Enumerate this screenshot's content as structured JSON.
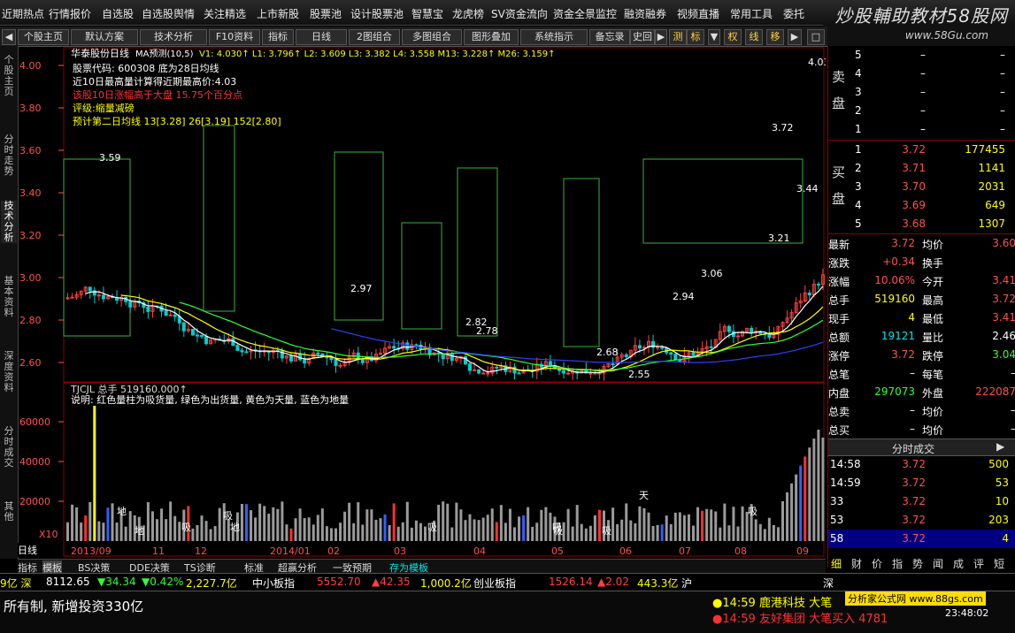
{
  "top_menu": [
    "近期热点",
    "行情报价",
    "自选股",
    "自选股舆情",
    "关注精选",
    "上市新股",
    "股票池",
    "设计股票池",
    "智慧宝",
    "龙虎榜",
    "SV资金流向",
    "资金全景监控",
    "融资融券",
    "视频直播",
    "常用工具",
    "委托"
  ],
  "watermark": {
    "title": "炒股輔助教材58股网",
    "url": "www.58Gu.com"
  },
  "toolbar": [
    "个股主页",
    "默认方案",
    "技术分析",
    "F10资料",
    "指标",
    "日线",
    "2图组合",
    "多图组合",
    "图形叠加",
    "系统指示",
    "备忘录",
    "史回"
  ],
  "toolbar_right": [
    "测",
    "标",
    "权",
    "线",
    "移"
  ],
  "side_tabs": [
    "个股主页",
    "分时走势",
    "技术分析",
    "基本资料",
    "深度资料",
    "分时成交",
    "其他"
  ],
  "chart": {
    "title": "华泰股份日线",
    "ma_label": "MA预测(10,5)",
    "ma_values": "V1: 4.030↑  L1: 3.796↑  L2: 3.609  L3: 3.382  L4: 3.558  M13: 3.228↑  M26: 3.159↑",
    "info_lines": [
      {
        "text": "股票代码: 600308 底为28日均线",
        "color": "#ffffff"
      },
      {
        "text": "近10日最高量计算得近期最高价:4.03",
        "color": "#ffffff"
      },
      {
        "text": "该股10日涨幅高于大盘 15.75个百分点",
        "color": "#ff3030"
      },
      {
        "text": "评级:缩量减磅",
        "color": "#ffff00"
      },
      {
        "text": "预计第二日均线 13[3.28] 26[3.19] 152[2.80]",
        "color": "#ffff00"
      }
    ],
    "y_ticks": [
      "4.00",
      "3.80",
      "3.60",
      "3.40",
      "3.20",
      "3.00",
      "2.80",
      "2.60"
    ],
    "price_annotations": [
      "3.59",
      "2.97",
      "2.82",
      "2.78",
      "2.68",
      "2.55",
      "2.94",
      "3.06",
      "3.21",
      "3.44",
      "3.72",
      "4.03"
    ],
    "volume_title": "TJCJL 总手  519160.000↑",
    "volume_note": "说明: 红色量柱为吸货量, 绿色为出货量, 黄色为天量, 蓝色为地量",
    "vol_y_ticks": [
      "60000",
      "40000",
      "20000"
    ],
    "vol_multiplier": "X10",
    "vol_markers": [
      "天",
      "地",
      "地",
      "吸",
      "地",
      "吸",
      "吸",
      "吸",
      "吸",
      "吸",
      "吸"
    ],
    "x_labels": [
      "2013/09",
      "11",
      "12",
      "2014/01",
      "02",
      "03",
      "04",
      "05",
      "06",
      "07",
      "08",
      "09"
    ],
    "period_label": "日线"
  },
  "order_book": {
    "sell_label": "卖盘",
    "buy_label": "买盘",
    "sell": [
      {
        "level": "5",
        "price": "–",
        "vol": "–"
      },
      {
        "level": "4",
        "price": "–",
        "vol": "–"
      },
      {
        "level": "3",
        "price": "–",
        "vol": "–"
      },
      {
        "level": "2",
        "price": "–",
        "vol": "–"
      },
      {
        "level": "1",
        "price": "–",
        "vol": "–"
      }
    ],
    "buy": [
      {
        "level": "1",
        "price": "3.72",
        "vol": "177455"
      },
      {
        "level": "2",
        "price": "3.71",
        "vol": "1141"
      },
      {
        "level": "3",
        "price": "3.70",
        "vol": "2031"
      },
      {
        "level": "4",
        "price": "3.69",
        "vol": "649"
      },
      {
        "level": "5",
        "price": "3.68",
        "vol": "1307"
      }
    ]
  },
  "quote": [
    {
      "l": "最新",
      "v": "3.72",
      "vc": "red",
      "l2": "均价",
      "v2": "3.60",
      "v2c": "red"
    },
    {
      "l": "涨跌",
      "v": "+0.34",
      "vc": "red",
      "l2": "换手",
      "v2": "",
      "v2c": "white"
    },
    {
      "l": "涨幅",
      "v": "10.06%",
      "vc": "red",
      "l2": "今开",
      "v2": "3.41",
      "v2c": "red"
    },
    {
      "l": "总手",
      "v": "519160",
      "vc": "yellow",
      "l2": "最高",
      "v2": "3.72",
      "v2c": "red"
    },
    {
      "l": "现手",
      "v": "4",
      "vc": "yellow",
      "l2": "最低",
      "v2": "3.41",
      "v2c": "red"
    },
    {
      "l": "总额",
      "v": "19121",
      "vc": "cyan",
      "l2": "量比",
      "v2": "2.46",
      "v2c": "white"
    },
    {
      "l": "涨停",
      "v": "3.72",
      "vc": "red",
      "l2": "跌停",
      "v2": "3.04",
      "v2c": "green"
    },
    {
      "l": "总笔",
      "v": "–",
      "vc": "white",
      "l2": "每笔",
      "v2": "–",
      "v2c": "white"
    },
    {
      "l": "内盘",
      "v": "297073",
      "vc": "green",
      "l2": "外盘",
      "v2": "222087",
      "v2c": "red"
    },
    {
      "l": "总卖",
      "v": "–",
      "vc": "white",
      "l2": "均价",
      "v2": "–",
      "v2c": "white"
    },
    {
      "l": "总买",
      "v": "–",
      "vc": "white",
      "l2": "均价",
      "v2": "–",
      "v2c": "white"
    }
  ],
  "ticks_header": "分时成交",
  "ticks": [
    {
      "t": "14:58",
      "p": "3.72",
      "v": "500"
    },
    {
      "t": "14:59",
      "p": "3.72",
      "v": "53"
    },
    {
      "t": "33",
      "p": "3.72",
      "v": "10"
    },
    {
      "t": "53",
      "p": "3.72",
      "v": "203"
    },
    {
      "t": "58",
      "p": "3.72",
      "v": "4"
    }
  ],
  "right_tabs": [
    "细",
    "财",
    "价",
    "指",
    "势",
    "闻",
    "成",
    "评",
    "短"
  ],
  "bottom_tabs": [
    "指标",
    "模板",
    "BS决策",
    "DDE决策",
    "TS诊断",
    "标准",
    "超赢分析",
    "一致预期",
    "存为模板"
  ],
  "ticker": [
    {
      "t": "9亿 深",
      "c": "yellow"
    },
    {
      "t": "8112.65",
      "c": "white"
    },
    {
      "t": "▼34.34",
      "c": "green"
    },
    {
      "t": "▼0.42%",
      "c": "green"
    },
    {
      "t": "2,227.7亿",
      "c": "yellow"
    },
    {
      "t": "中小板指",
      "c": "white"
    },
    {
      "t": "5552.70",
      "c": "red"
    },
    {
      "t": "▲42.35",
      "c": "red"
    },
    {
      "t": "1,000.2亿",
      "c": "yellow"
    },
    {
      "t": "创业板指",
      "c": "white"
    },
    {
      "t": "1526.14",
      "c": "red"
    },
    {
      "t": "▲2.02",
      "c": "red"
    },
    {
      "t": "443.3亿",
      "c": "yellow"
    },
    {
      "t": "沪",
      "c": "white"
    },
    {
      "t": "深",
      "c": "white"
    }
  ],
  "status": {
    "left": "所有制, 新增投资330亿",
    "news1": "●14:59 鹿港科技 大笔",
    "news2": "●14:59 友好集团 大笔买入 4781",
    "promo": "分析家公式网 www.88gs.com",
    "time": "23:48:02"
  }
}
